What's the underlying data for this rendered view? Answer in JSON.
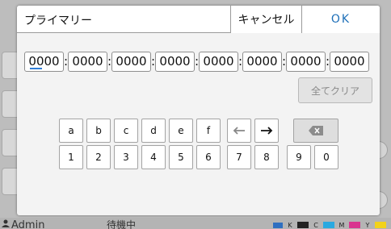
{
  "dialog": {
    "title": "プライマリー",
    "cancel_label": "キャンセル",
    "ok_label": "OK"
  },
  "address": {
    "octets": [
      "0000",
      "0000",
      "0000",
      "0000",
      "0000",
      "0000",
      "0000",
      "0000"
    ],
    "separator": ":",
    "active_index": 0
  },
  "clear_label": "全てクリア",
  "keypad": {
    "row1": [
      "a",
      "b",
      "c",
      "d",
      "e",
      "f"
    ],
    "row2": [
      "1",
      "2",
      "3",
      "4",
      "5",
      "6",
      "7",
      "8",
      "9",
      "0"
    ],
    "left_arrow_icon": "arrow-left-icon",
    "right_arrow_icon": "arrow-right-icon",
    "backspace_icon": "backspace-icon"
  },
  "status": {
    "user": "Admin",
    "message": "待機中",
    "ink_labels": [
      "K",
      "C",
      "M",
      "Y"
    ]
  },
  "colors": {
    "ok": "#1d6fb8",
    "cursor": "#2f7ed8"
  }
}
